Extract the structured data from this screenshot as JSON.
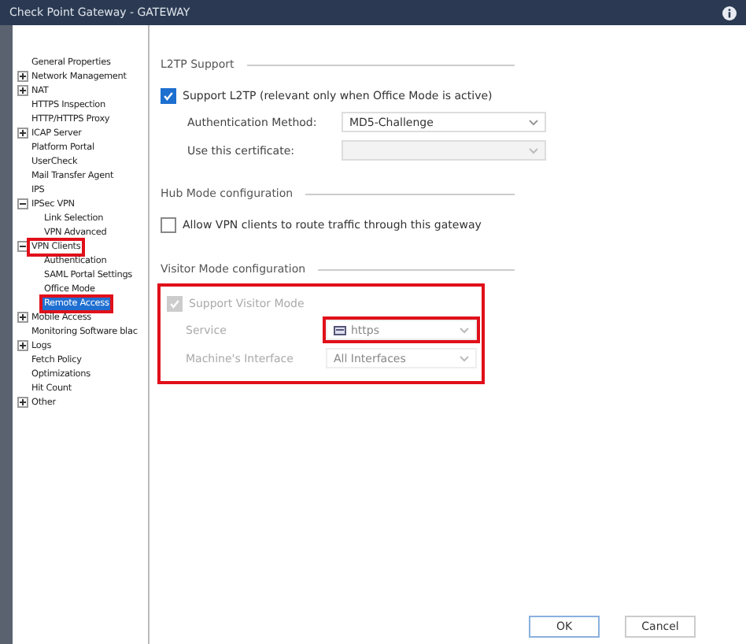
{
  "window": {
    "title": "Check Point Gateway - GATEWAY"
  },
  "tree": [
    {
      "label": "General Properties",
      "selected": false,
      "highlighted": false
    },
    {
      "label": "Network Management",
      "selected": false,
      "highlighted": false,
      "expanded": false
    },
    {
      "label": "NAT",
      "selected": false,
      "highlighted": false,
      "expanded": false
    },
    {
      "label": "HTTPS Inspection",
      "selected": false,
      "highlighted": false
    },
    {
      "label": "HTTP/HTTPS Proxy",
      "selected": false,
      "highlighted": false
    },
    {
      "label": "ICAP Server",
      "selected": false,
      "highlighted": false,
      "expanded": false
    },
    {
      "label": "Platform Portal",
      "selected": false,
      "highlighted": false
    },
    {
      "label": "UserCheck",
      "selected": false,
      "highlighted": false
    },
    {
      "label": "Mail Transfer Agent",
      "selected": false,
      "highlighted": false
    },
    {
      "label": "IPS",
      "selected": false,
      "highlighted": false
    },
    {
      "label": "IPSec VPN",
      "selected": false,
      "highlighted": false,
      "expanded": true,
      "children": [
        {
          "label": "Link Selection",
          "selected": false,
          "highlighted": false
        },
        {
          "label": "VPN Advanced",
          "selected": false,
          "highlighted": false
        }
      ]
    },
    {
      "label": "VPN Clients",
      "selected": false,
      "highlighted": true,
      "expanded": true,
      "children": [
        {
          "label": "Authentication",
          "selected": false,
          "highlighted": false
        },
        {
          "label": "SAML Portal Settings",
          "selected": false,
          "highlighted": false
        },
        {
          "label": "Office Mode",
          "selected": false,
          "highlighted": false
        },
        {
          "label": "Remote Access",
          "selected": true,
          "highlighted": true
        }
      ]
    },
    {
      "label": "Mobile Access",
      "selected": false,
      "highlighted": false,
      "expanded": false
    },
    {
      "label": "Monitoring Software blac",
      "selected": false,
      "highlighted": false
    },
    {
      "label": "Logs",
      "selected": false,
      "highlighted": false,
      "expanded": false
    },
    {
      "label": "Fetch Policy",
      "selected": false,
      "highlighted": false
    },
    {
      "label": "Optimizations",
      "selected": false,
      "highlighted": false
    },
    {
      "label": "Hit Count",
      "selected": false,
      "highlighted": false
    },
    {
      "label": "Other",
      "selected": false,
      "highlighted": false,
      "expanded": false
    }
  ],
  "l2tp": {
    "heading": "L2TP Support",
    "checkbox": {
      "label": "Support L2TP (relevant only when Office Mode is active)",
      "checked": true
    },
    "auth_label": "Authentication Method:",
    "auth_value": "MD5-Challenge",
    "cert_label": "Use this certificate:"
  },
  "hub": {
    "heading": "Hub Mode configuration",
    "checkbox": {
      "label": "Allow VPN clients to route traffic through this gateway",
      "checked": false
    }
  },
  "visitor": {
    "heading": "Visitor Mode configuration",
    "highlighted": true,
    "checkbox": {
      "label": "Support Visitor Mode",
      "checked": true,
      "disabled": true
    },
    "service_label": "Service",
    "service_value": "https",
    "service_highlighted": true,
    "interface_label": "Machine's Interface",
    "interface_value": "All Interfaces"
  },
  "buttons": [
    "OK",
    "Cancel"
  ]
}
